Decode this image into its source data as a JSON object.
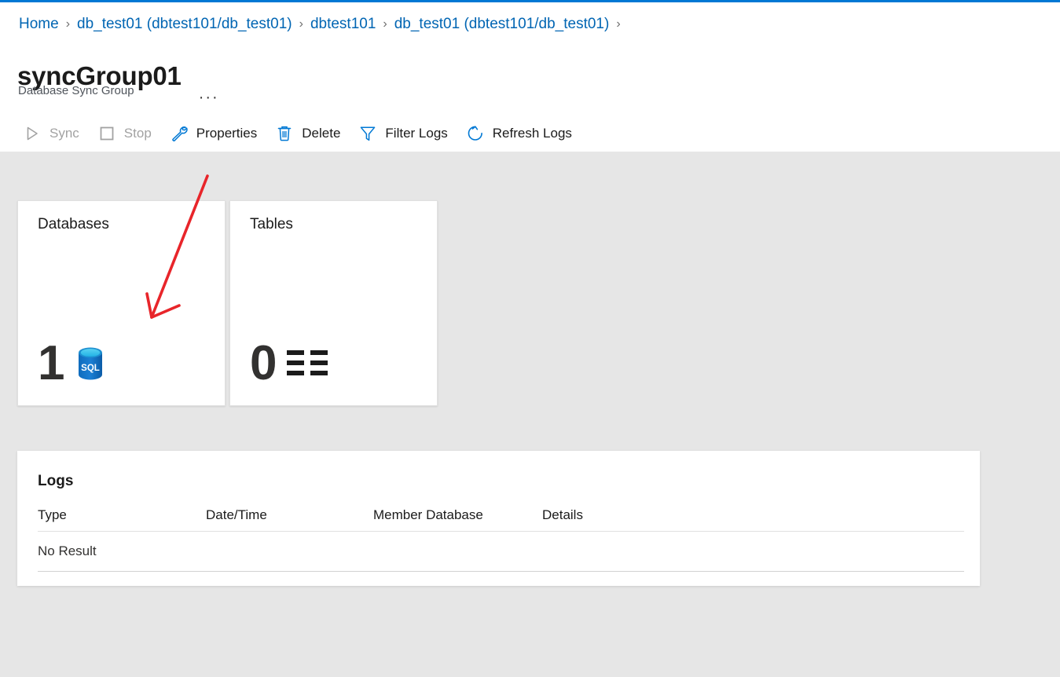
{
  "theme": {
    "accent": "#0078d4",
    "link": "#0065b3",
    "page_background": "#e6e6e6",
    "panel_background": "#ffffff",
    "text": "#1b1b1b",
    "disabled_text": "#a2a2a2",
    "annotation": "#e8252a"
  },
  "breadcrumb": {
    "separator": "›",
    "items": [
      {
        "label": "Home"
      },
      {
        "label": "db_test01 (dbtest101/db_test01)"
      },
      {
        "label": "dbtest101"
      },
      {
        "label": "db_test01 (dbtest101/db_test01)"
      }
    ]
  },
  "header": {
    "title": "syncGroup01",
    "ellipsis": "···",
    "subtitle": "Database Sync Group"
  },
  "toolbar": {
    "items": [
      {
        "label": "Sync",
        "icon": "play-icon",
        "disabled": true
      },
      {
        "label": "Stop",
        "icon": "stop-icon",
        "disabled": true
      },
      {
        "label": "Properties",
        "icon": "wrench-icon",
        "disabled": false
      },
      {
        "label": "Delete",
        "icon": "trash-icon",
        "disabled": false
      },
      {
        "label": "Filter Logs",
        "icon": "filter-icon",
        "disabled": false
      },
      {
        "label": "Refresh Logs",
        "icon": "refresh-icon",
        "disabled": false
      }
    ]
  },
  "tiles": [
    {
      "title": "Databases",
      "count": "1",
      "icon": "sql-database-icon"
    },
    {
      "title": "Tables",
      "count": "0",
      "icon": "table-grid-icon"
    }
  ],
  "logs": {
    "title": "Logs",
    "columns": [
      "Type",
      "Date/Time",
      "Member Database",
      "Details"
    ],
    "rows": [
      {
        "type": "No Result",
        "date": "",
        "member": "",
        "details": ""
      }
    ]
  }
}
